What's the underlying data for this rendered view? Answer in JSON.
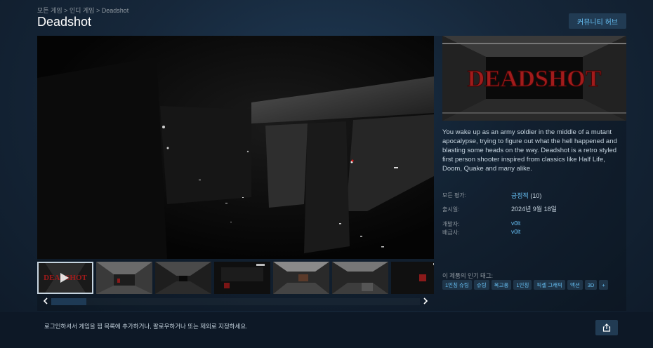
{
  "breadcrumb": "모든 게임 > 인디 게임 > Deadshot",
  "title": "Deadshot",
  "hub_button": "커뮤니티 허브",
  "capsule_logo_text": "DEADSHOT",
  "thumb_logo_text": "DEADSHOT",
  "description": "You wake up as an army soldier in the middle of a mutant apocalypse, trying to figure out what the hell happened and blasting some heads on the way. Deadshot is a retro styled first person shooter inspired from classics like Half Life, Doom, Quake and many alike.",
  "reviews": {
    "label": "모든 평가:",
    "value": "긍정적",
    "count": "(10)"
  },
  "release": {
    "label": "출시일:",
    "value": "2024년 9월 18일"
  },
  "developer": {
    "label": "개발자:",
    "value": "v0lt"
  },
  "publisher": {
    "label": "배급사:",
    "value": "v0lt"
  },
  "tags_label": "이 제품의 인기 태그:",
  "tags": [
    "1인칭 슈팅",
    "슈팅",
    "복고풍",
    "1인칭",
    "픽셀 그래픽",
    "액션",
    "3D",
    "+"
  ],
  "login_notice": "로그인하셔서 게임을 찜 목록에 추가하거나, 팔로우하거나 또는 제외로 지정하세요.",
  "colors": {
    "accent": "#67c1f5",
    "title_red": "#a11b1b",
    "background": "#1b2838"
  },
  "icons": {
    "prev": "chevron-left-icon",
    "next": "chevron-right-icon",
    "play": "play-icon",
    "share": "share-icon"
  }
}
